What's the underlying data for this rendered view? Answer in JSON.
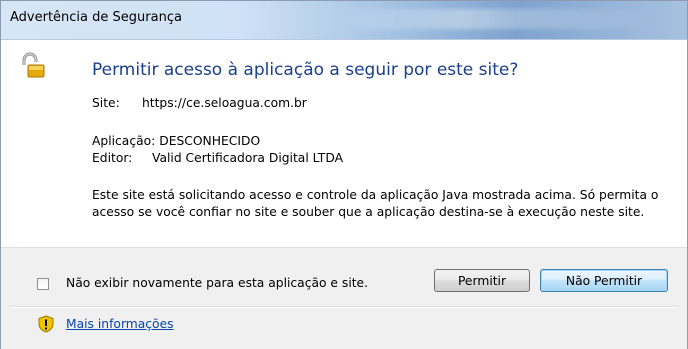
{
  "window": {
    "title": "Advertência de Segurança"
  },
  "dialog": {
    "heading": "Permitir acesso à aplicação a seguir por este site?",
    "site_label": "Site:",
    "site_value": "https://ce.seloagua.com.br",
    "app_label": "Aplicação:",
    "app_value": "DESCONHECIDO",
    "publisher_label": "Editor:",
    "publisher_value": "Valid Certificadora Digital LTDA",
    "description": "Este site está solicitando acesso e controle da aplicação Java mostrada acima. Só permita o acesso se você confiar no site e souber que a aplicação destina-se à execução neste site."
  },
  "footer": {
    "checkbox_label": "Não exibir novamente para esta aplicação e site.",
    "checkbox_checked": false,
    "allow_button": "Permitir",
    "deny_button": "Não Permitir",
    "more_info_link": "Mais informações"
  },
  "icons": {
    "header_icon": "padlock-icon",
    "footer_icon": "warning-shield-icon"
  },
  "colors": {
    "heading": "#1a3f8c",
    "link": "#0645ad",
    "default_button_border": "#3c7fb1"
  }
}
